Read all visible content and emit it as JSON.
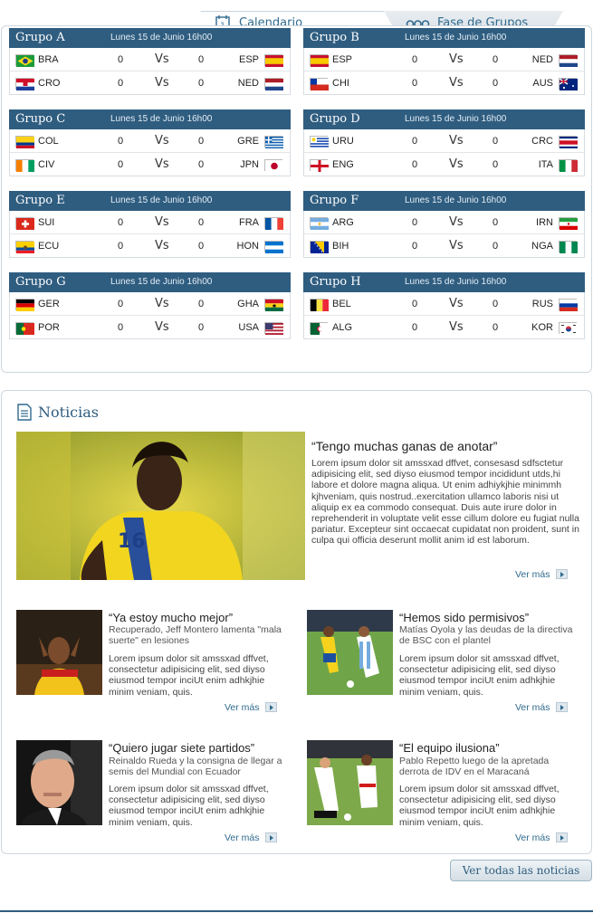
{
  "tabs": {
    "calendario": "Calendario",
    "fase": "Fase de Grupos"
  },
  "groups": [
    {
      "name": "Grupo A",
      "date": "Lunes 15 de Junio 16h00",
      "matches": [
        {
          "home": "BRA",
          "hs": "0",
          "vs": "Vs",
          "as": "0",
          "away": "ESP"
        },
        {
          "home": "CRO",
          "hs": "0",
          "vs": "Vs",
          "as": "0",
          "away": "NED"
        }
      ]
    },
    {
      "name": "Grupo B",
      "date": "Lunes 15 de Junio 16h00",
      "matches": [
        {
          "home": "ESP",
          "hs": "0",
          "vs": "Vs",
          "as": "0",
          "away": "NED"
        },
        {
          "home": "CHI",
          "hs": "0",
          "vs": "Vs",
          "as": "0",
          "away": "AUS"
        }
      ]
    },
    {
      "name": "Grupo C",
      "date": "Lunes 15 de Junio 16h00",
      "matches": [
        {
          "home": "COL",
          "hs": "0",
          "vs": "Vs",
          "as": "0",
          "away": "GRE"
        },
        {
          "home": "CIV",
          "hs": "0",
          "vs": "Vs",
          "as": "0",
          "away": "JPN"
        }
      ]
    },
    {
      "name": "Grupo D",
      "date": "Lunes 15 de Junio 16h00",
      "matches": [
        {
          "home": "URU",
          "hs": "0",
          "vs": "Vs",
          "as": "0",
          "away": "CRC"
        },
        {
          "home": "ENG",
          "hs": "0",
          "vs": "Vs",
          "as": "0",
          "away": "ITA"
        }
      ]
    },
    {
      "name": "Grupo E",
      "date": "Lunes 15 de Junio 16h00",
      "matches": [
        {
          "home": "SUI",
          "hs": "0",
          "vs": "Vs",
          "as": "0",
          "away": "FRA"
        },
        {
          "home": "ECU",
          "hs": "0",
          "vs": "Vs",
          "as": "0",
          "away": "HON"
        }
      ]
    },
    {
      "name": "Grupo F",
      "date": "Lunes 15 de Junio 16h00",
      "matches": [
        {
          "home": "ARG",
          "hs": "0",
          "vs": "Vs",
          "as": "0",
          "away": "IRN"
        },
        {
          "home": "BIH",
          "hs": "0",
          "vs": "Vs",
          "as": "0",
          "away": "NGA"
        }
      ]
    },
    {
      "name": "Grupo G",
      "date": "Lunes 15 de Junio 16h00",
      "matches": [
        {
          "home": "GER",
          "hs": "0",
          "vs": "Vs",
          "as": "0",
          "away": "GHA"
        },
        {
          "home": "POR",
          "hs": "0",
          "vs": "Vs",
          "as": "0",
          "away": "USA"
        }
      ]
    },
    {
      "name": "Grupo H",
      "date": "Lunes 15 de Junio 16h00",
      "matches": [
        {
          "home": "BEL",
          "hs": "0",
          "vs": "Vs",
          "as": "0",
          "away": "RUS"
        },
        {
          "home": "ALG",
          "hs": "0",
          "vs": "Vs",
          "as": "0",
          "away": "KOR"
        }
      ]
    }
  ],
  "news": {
    "title": "Noticias",
    "featured": {
      "headline": "“Tengo muchas ganas de anotar”",
      "body": "Lorem ipsum dolor sit amssxad dffvet, consesasd sdfsctetur adipisicing elit, sed diyso eiusmod tempor incididunt utds,hi labore et dolore magna aliqua. Ut enim adhiykjhie minimmh kjhveniam, quis nostrud..exercitation ullamco laboris nisi ut aliquip ex ea commodo consequat. Duis aute irure dolor in reprehenderit in voluptate velit esse cillum dolore eu fugiat nulla pariatur. Excepteur sint occaecat cupidatat non proident, sunt in culpa qui officia deserunt mollit anim id est laborum.",
      "more": "Ver más"
    },
    "items": [
      {
        "headline": "“Ya estoy mucho mejor”",
        "sub": "Recuperado, Jeff Montero lamenta \"mala suerte\" en lesiones",
        "body": "Lorem ipsum dolor sit amssxad dffvet, consectetur adipisicing elit, sed diyso eiusmod tempor inciUt enim adhkjhie minim veniam, quis.",
        "more": "Ver más"
      },
      {
        "headline": "“Hemos sido permisivos”",
        "sub": "Matías Oyola y las deudas de la directiva de BSC con el plantel",
        "body": "Lorem ipsum dolor sit amssxad dffvet, consectetur adipisicing elit, sed diyso eiusmod tempor inciUt enim adhkjhie minim veniam, quis.",
        "more": "Ver más"
      },
      {
        "headline": "“Quiero jugar siete partidos”",
        "sub": "Reinaldo Rueda y la consigna de llegar a semis del Mundial con Ecuador",
        "body": "Lorem ipsum dolor sit amssxad dffvet, consectetur adipisicing elit, sed diyso eiusmod tempor inciUt enim adhkjhie minim veniam, quis.",
        "more": "Ver más"
      },
      {
        "headline": "“El equipo ilusiona”",
        "sub": "Pablo Repetto luego de la apretada derrota de IDV en el Maracaná",
        "body": "Lorem ipsum dolor sit amssxad dffvet, consectetur adipisicing elit, sed diyso eiusmod tempor inciUt enim adhkjhie minim veniam, quis.",
        "more": "Ver más"
      }
    ],
    "all_button": "Ver todas las noticias"
  },
  "colors": {
    "header_blue": "#2f5d80",
    "link_blue": "#2f6a8e",
    "panel_border": "#cfd7dd"
  }
}
